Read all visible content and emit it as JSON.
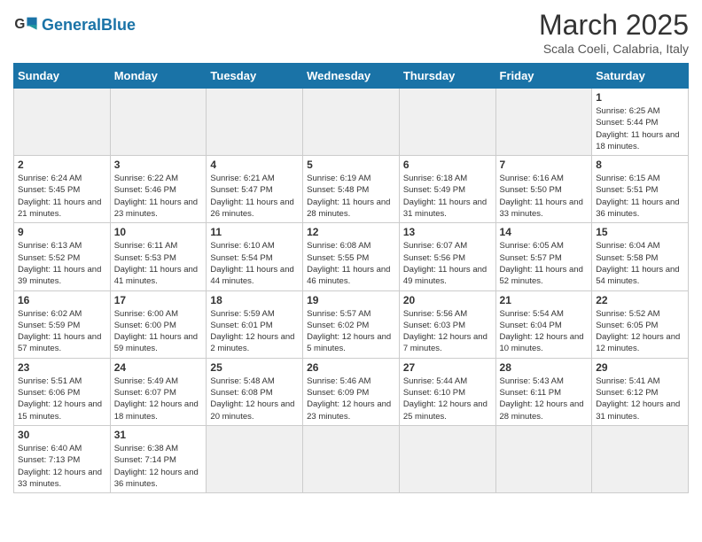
{
  "header": {
    "logo_general": "General",
    "logo_blue": "Blue",
    "month": "March 2025",
    "location": "Scala Coeli, Calabria, Italy"
  },
  "days": [
    "Sunday",
    "Monday",
    "Tuesday",
    "Wednesday",
    "Thursday",
    "Friday",
    "Saturday"
  ],
  "weeks": [
    [
      {
        "date": "",
        "empty": true
      },
      {
        "date": "",
        "empty": true
      },
      {
        "date": "",
        "empty": true
      },
      {
        "date": "",
        "empty": true
      },
      {
        "date": "",
        "empty": true
      },
      {
        "date": "",
        "empty": true
      },
      {
        "date": "1",
        "sunrise": "6:25 AM",
        "sunset": "5:44 PM",
        "daylight": "11 hours and 18 minutes."
      }
    ],
    [
      {
        "date": "2",
        "sunrise": "6:24 AM",
        "sunset": "5:45 PM",
        "daylight": "11 hours and 21 minutes."
      },
      {
        "date": "3",
        "sunrise": "6:22 AM",
        "sunset": "5:46 PM",
        "daylight": "11 hours and 23 minutes."
      },
      {
        "date": "4",
        "sunrise": "6:21 AM",
        "sunset": "5:47 PM",
        "daylight": "11 hours and 26 minutes."
      },
      {
        "date": "5",
        "sunrise": "6:19 AM",
        "sunset": "5:48 PM",
        "daylight": "11 hours and 28 minutes."
      },
      {
        "date": "6",
        "sunrise": "6:18 AM",
        "sunset": "5:49 PM",
        "daylight": "11 hours and 31 minutes."
      },
      {
        "date": "7",
        "sunrise": "6:16 AM",
        "sunset": "5:50 PM",
        "daylight": "11 hours and 33 minutes."
      },
      {
        "date": "8",
        "sunrise": "6:15 AM",
        "sunset": "5:51 PM",
        "daylight": "11 hours and 36 minutes."
      }
    ],
    [
      {
        "date": "9",
        "sunrise": "6:13 AM",
        "sunset": "5:52 PM",
        "daylight": "11 hours and 39 minutes."
      },
      {
        "date": "10",
        "sunrise": "6:11 AM",
        "sunset": "5:53 PM",
        "daylight": "11 hours and 41 minutes."
      },
      {
        "date": "11",
        "sunrise": "6:10 AM",
        "sunset": "5:54 PM",
        "daylight": "11 hours and 44 minutes."
      },
      {
        "date": "12",
        "sunrise": "6:08 AM",
        "sunset": "5:55 PM",
        "daylight": "11 hours and 46 minutes."
      },
      {
        "date": "13",
        "sunrise": "6:07 AM",
        "sunset": "5:56 PM",
        "daylight": "11 hours and 49 minutes."
      },
      {
        "date": "14",
        "sunrise": "6:05 AM",
        "sunset": "5:57 PM",
        "daylight": "11 hours and 52 minutes."
      },
      {
        "date": "15",
        "sunrise": "6:04 AM",
        "sunset": "5:58 PM",
        "daylight": "11 hours and 54 minutes."
      }
    ],
    [
      {
        "date": "16",
        "sunrise": "6:02 AM",
        "sunset": "5:59 PM",
        "daylight": "11 hours and 57 minutes."
      },
      {
        "date": "17",
        "sunrise": "6:00 AM",
        "sunset": "6:00 PM",
        "daylight": "11 hours and 59 minutes."
      },
      {
        "date": "18",
        "sunrise": "5:59 AM",
        "sunset": "6:01 PM",
        "daylight": "12 hours and 2 minutes."
      },
      {
        "date": "19",
        "sunrise": "5:57 AM",
        "sunset": "6:02 PM",
        "daylight": "12 hours and 5 minutes."
      },
      {
        "date": "20",
        "sunrise": "5:56 AM",
        "sunset": "6:03 PM",
        "daylight": "12 hours and 7 minutes."
      },
      {
        "date": "21",
        "sunrise": "5:54 AM",
        "sunset": "6:04 PM",
        "daylight": "12 hours and 10 minutes."
      },
      {
        "date": "22",
        "sunrise": "5:52 AM",
        "sunset": "6:05 PM",
        "daylight": "12 hours and 12 minutes."
      }
    ],
    [
      {
        "date": "23",
        "sunrise": "5:51 AM",
        "sunset": "6:06 PM",
        "daylight": "12 hours and 15 minutes."
      },
      {
        "date": "24",
        "sunrise": "5:49 AM",
        "sunset": "6:07 PM",
        "daylight": "12 hours and 18 minutes."
      },
      {
        "date": "25",
        "sunrise": "5:48 AM",
        "sunset": "6:08 PM",
        "daylight": "12 hours and 20 minutes."
      },
      {
        "date": "26",
        "sunrise": "5:46 AM",
        "sunset": "6:09 PM",
        "daylight": "12 hours and 23 minutes."
      },
      {
        "date": "27",
        "sunrise": "5:44 AM",
        "sunset": "6:10 PM",
        "daylight": "12 hours and 25 minutes."
      },
      {
        "date": "28",
        "sunrise": "5:43 AM",
        "sunset": "6:11 PM",
        "daylight": "12 hours and 28 minutes."
      },
      {
        "date": "29",
        "sunrise": "5:41 AM",
        "sunset": "6:12 PM",
        "daylight": "12 hours and 31 minutes."
      }
    ],
    [
      {
        "date": "30",
        "sunrise": "6:40 AM",
        "sunset": "7:13 PM",
        "daylight": "12 hours and 33 minutes."
      },
      {
        "date": "31",
        "sunrise": "6:38 AM",
        "sunset": "7:14 PM",
        "daylight": "12 hours and 36 minutes."
      },
      {
        "date": "",
        "empty": true
      },
      {
        "date": "",
        "empty": true
      },
      {
        "date": "",
        "empty": true
      },
      {
        "date": "",
        "empty": true
      },
      {
        "date": "",
        "empty": true
      }
    ]
  ]
}
